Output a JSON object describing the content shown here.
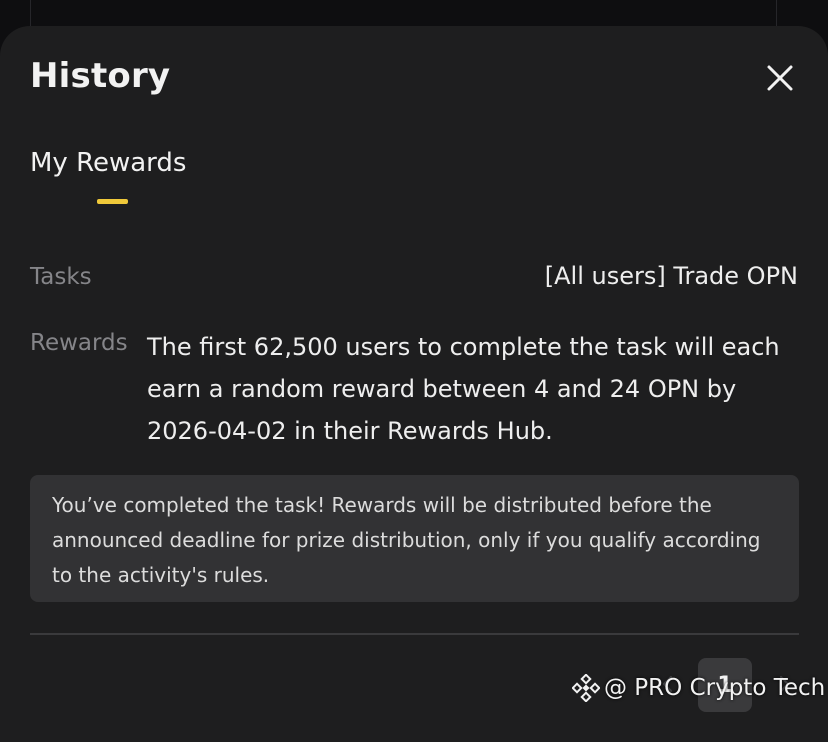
{
  "header": {
    "title": "History",
    "close_icon": "close-icon"
  },
  "tabs": [
    {
      "label": "My Rewards",
      "active": true
    }
  ],
  "colors": {
    "accent": "#f0c93a",
    "sheet_background": "#1e1e1f",
    "notice_background": "#323234",
    "label_text": "#858589",
    "value_text": "#eeeeee"
  },
  "details": {
    "tasks": {
      "label": "Tasks",
      "value": "[All users] Trade OPN"
    },
    "rewards": {
      "label": "Rewards",
      "value": "The first 62,500 users to complete the task will each earn a random reward between 4 and 24 OPN by 2026-04-02 in their Rewards Hub."
    }
  },
  "notice": {
    "text": "You’ve completed the task! Rewards will be distributed before the announced deadline for prize distribution, only if you qualify according to the activity's rules."
  },
  "pagination": {
    "current_page": "1",
    "prev_icon": "chevron-left-icon",
    "next_icon": "chevron-right-icon"
  },
  "watermark": {
    "text": "@ PRO Crypto Tech",
    "logo_icon": "diamond-logo-icon"
  }
}
